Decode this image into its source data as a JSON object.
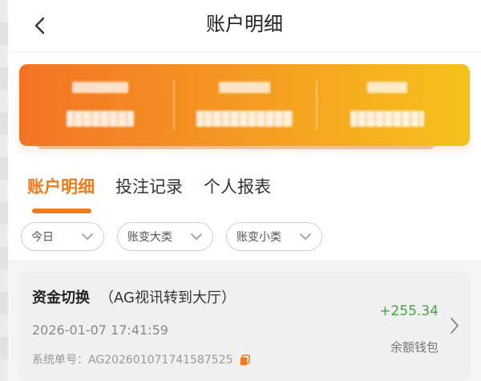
{
  "header": {
    "title": "账户明细",
    "back_icon": "chevron-left-icon"
  },
  "summary": {
    "gradient_start": "#f37325",
    "gradient_end": "#f6c21c",
    "content": "blurred"
  },
  "tabs": [
    {
      "label": "账户明细",
      "active": true
    },
    {
      "label": "投注记录",
      "active": false
    },
    {
      "label": "个人报表",
      "active": false
    }
  ],
  "filters": [
    {
      "label": "今日"
    },
    {
      "label": "账变大类"
    },
    {
      "label": "账变小类"
    }
  ],
  "record": {
    "type": "资金切换",
    "detail": "（AG视讯转到大厅）",
    "time": "2026-01-07 17:41:59",
    "order_label": "系统单号：",
    "order_no": "AG202601071741587525",
    "amount": "+255.34",
    "wallet": "余额钱包"
  },
  "colors": {
    "accent": "#f07a1c",
    "positive": "#3aa93a"
  }
}
